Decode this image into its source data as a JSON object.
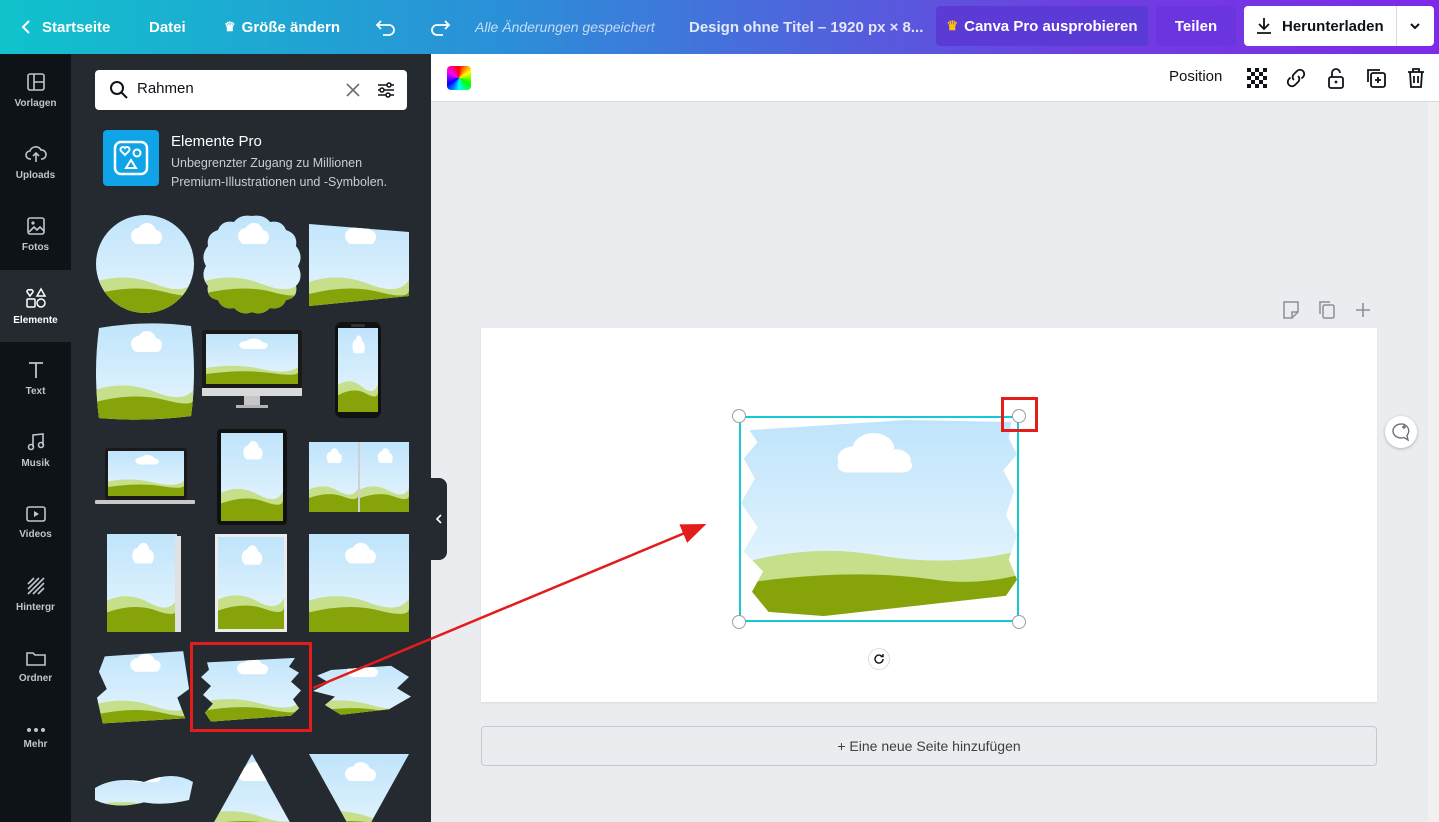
{
  "topbar": {
    "home": "Startseite",
    "file": "Datei",
    "resize": "Größe ändern",
    "saved_status": "Alle Änderungen gespeichert",
    "design_title": "Design ohne Titel – 1920 px × 8...",
    "try_pro": "Canva Pro ausprobieren",
    "share": "Teilen",
    "download": "Herunterladen"
  },
  "rail": {
    "items": [
      {
        "label": "Vorlagen",
        "icon": "templates-icon"
      },
      {
        "label": "Uploads",
        "icon": "upload-cloud-icon"
      },
      {
        "label": "Fotos",
        "icon": "photo-icon"
      },
      {
        "label": "Elemente",
        "icon": "elements-icon"
      },
      {
        "label": "Text",
        "icon": "text-icon"
      },
      {
        "label": "Musik",
        "icon": "music-icon"
      },
      {
        "label": "Videos",
        "icon": "video-icon"
      },
      {
        "label": "Hintergr",
        "icon": "background-icon"
      },
      {
        "label": "Ordner",
        "icon": "folder-icon"
      },
      {
        "label": "Mehr",
        "icon": "more-icon"
      }
    ],
    "active_index": 3
  },
  "panel": {
    "search_value": "Rahmen",
    "promo_title": "Elemente Pro",
    "promo_line1": "Unbegrenzter Zugang zu Millionen",
    "promo_line2": "Premium-Illustrationen und -Symbolen."
  },
  "toolbar": {
    "position": "Position"
  },
  "canvas": {
    "add_page": "+ Eine neue Seite hinzufügen"
  },
  "colors": {
    "accent": "#7d2ae8",
    "selection": "#14c8d4",
    "highlight": "#e31c1c",
    "sky": "#cfeafc",
    "grass_light": "#c5df8a",
    "grass_dark": "#86a30a"
  }
}
